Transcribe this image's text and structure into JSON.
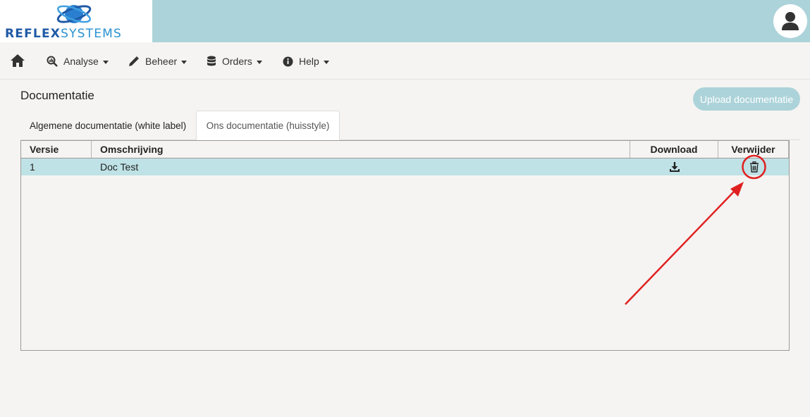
{
  "brand": {
    "name_part1": "REFLEX",
    "name_part2": "SYSTEMS"
  },
  "header": {
    "user_icon": "user-icon"
  },
  "nav": {
    "home_icon": "home-icon",
    "items": [
      {
        "label": "Analyse",
        "icon": "chart-search-icon"
      },
      {
        "label": "Beheer",
        "icon": "pencil-icon"
      },
      {
        "label": "Orders",
        "icon": "database-icon"
      },
      {
        "label": "Help",
        "icon": "info-icon"
      }
    ]
  },
  "page": {
    "title": "Documentatie",
    "upload_label": "Upload documentatie"
  },
  "tabs": [
    {
      "label": "Algemene documentatie (white label)",
      "active": false
    },
    {
      "label": "Ons documentatie (huisstyle)",
      "active": true
    }
  ],
  "table": {
    "columns": [
      "Versie",
      "Omschrijving",
      "Download",
      "Verwijder"
    ],
    "rows": [
      {
        "versie": "1",
        "omschrijving": "Doc Test",
        "download_icon": "download-icon",
        "delete_icon": "trash-icon"
      }
    ]
  },
  "colors": {
    "header_bg": "#acd3d9",
    "row_selected": "#bfe2e6",
    "annotation": "#e02020"
  }
}
